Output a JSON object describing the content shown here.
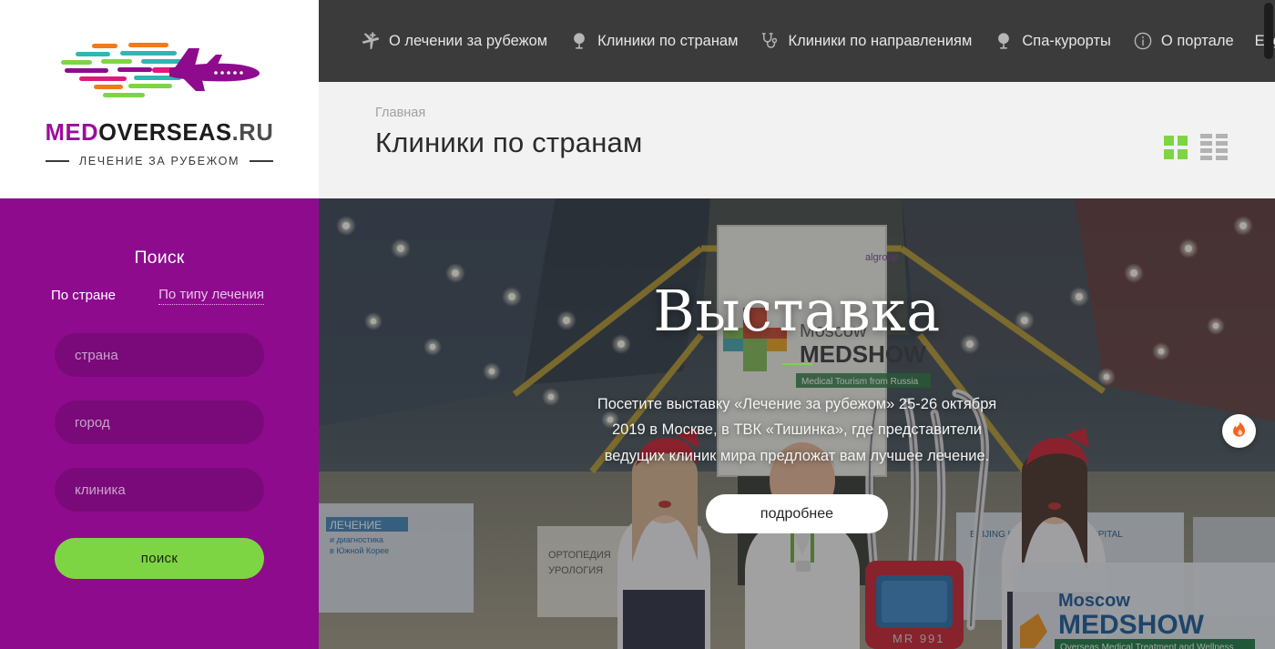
{
  "brand": {
    "word_med": "MED",
    "word_overseas": "OVERSEAS",
    "word_ru": ".RU",
    "tagline": "ЛЕЧЕНИЕ ЗА РУБЕЖОМ",
    "logo_alt": "airplane-with-color-streaks-logo",
    "plane_color": "#8e0b8e"
  },
  "topnav": {
    "items": [
      {
        "label": "О лечении за рубежом",
        "icon": "plane-plus-icon"
      },
      {
        "label": "Клиники по странам",
        "icon": "globe-icon"
      },
      {
        "label": "Клиники по направлениям",
        "icon": "stethoscope-icon"
      },
      {
        "label": "Спа-курорты",
        "icon": "globe-icon"
      },
      {
        "label": "О портале",
        "icon": "info-circle-icon"
      },
      {
        "label": "English",
        "icon": "none"
      }
    ],
    "background": "#3b3b3b"
  },
  "page_header": {
    "breadcrumb": "Главная",
    "title": "Клиники по странам",
    "views": [
      {
        "name": "grid-view",
        "label": "Плитка",
        "active": true,
        "color": "#7ed544"
      },
      {
        "name": "list-view",
        "label": "Список",
        "active": false,
        "color": "#b2b2b2"
      }
    ]
  },
  "sidebar": {
    "background": "#8e0b8e",
    "search_title": "Поиск",
    "tabs": [
      {
        "label": "По стране",
        "active": true
      },
      {
        "label": "По типу лечения",
        "active": false
      }
    ],
    "fields": [
      {
        "name": "country",
        "placeholder": "страна",
        "value": ""
      },
      {
        "name": "city",
        "placeholder": "город",
        "value": ""
      },
      {
        "name": "clinic",
        "placeholder": "клиника",
        "value": ""
      }
    ],
    "submit_label": "поиск",
    "submit_color": "#7ed544"
  },
  "hero": {
    "title": "Выставка",
    "description": "Посетите выставку «Лечение за рубежом» 25-26 октября 2019 в Москве, в ТВК «Тишинка», где представители ведущих клиник мира предложат вам лучшее лечение.",
    "button_label": "подробнее",
    "accent_color": "#7ed544",
    "image_alt": "moscow-medshow-exhibition-hall-photo",
    "banner_texts": {
      "main_sign_city": "Moscow",
      "main_sign_name": "MEDSHOW",
      "main_sign_sub": "Medical Tourism from Russia",
      "corner_sign_city": "Moscow",
      "corner_sign_name": "MEDSHOW",
      "corner_sign_sub": "Overseas Medical Treatment and Wellness"
    }
  },
  "floating_action": {
    "icon": "flame-icon",
    "color": "#f4651f"
  },
  "scrollbar": {
    "name": "page-scrollbar"
  }
}
